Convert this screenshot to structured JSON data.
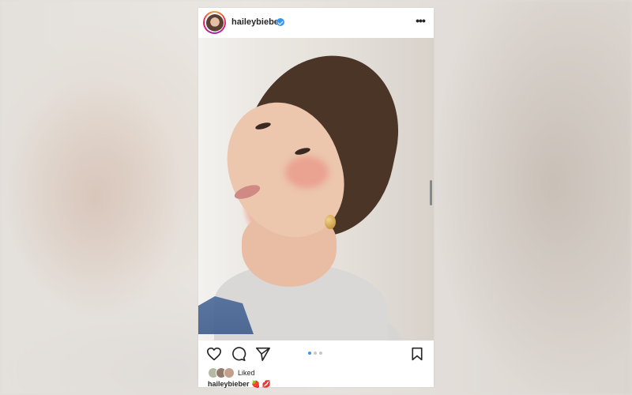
{
  "post": {
    "username": "haileybieber",
    "verified_icon": "verified-badge-icon",
    "more_icon": "more-options-icon"
  },
  "carousel": {
    "total_images": 3,
    "active_index": 1
  },
  "actions": {
    "icons": [
      "heart-icon",
      "comment-icon",
      "share-icon",
      "bookmark-icon"
    ]
  },
  "likes": {
    "text": "Liked"
  },
  "caption": {
    "username": "haileybieber",
    "text": "🍓 💋"
  },
  "colors": {
    "accent_blue": "#3897f0",
    "text": "#262626"
  }
}
